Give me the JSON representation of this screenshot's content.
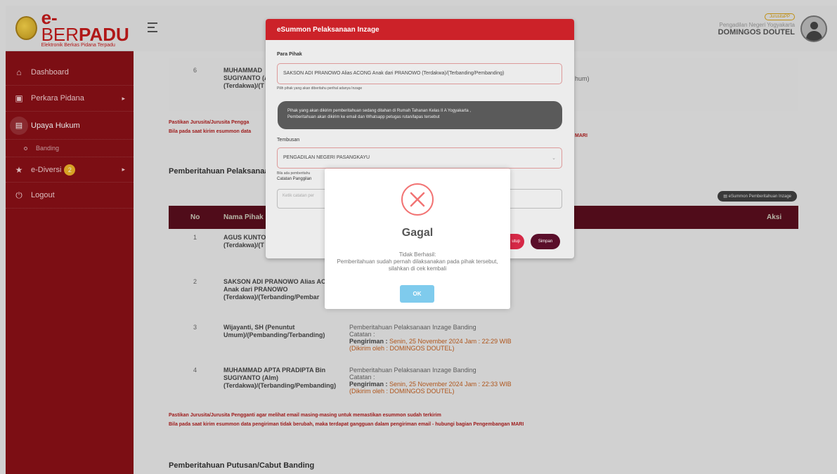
{
  "logo": {
    "brand_e": "e-",
    "brand_ber": "BER",
    "brand_padu": "PADU",
    "subtitle": "Elektronik Berkas Pidana Terpadu"
  },
  "sidebar": {
    "items": [
      {
        "label": "Dashboard",
        "icon": "home-icon"
      },
      {
        "label": "Perkara Pidana",
        "icon": "folder-icon"
      },
      {
        "label": "Upaya Hukum",
        "icon": "document-icon"
      },
      {
        "label": "Banding",
        "icon": "circle-icon"
      },
      {
        "label": "e-Diversi",
        "icon": "star-icon",
        "badge": "2"
      },
      {
        "label": "Logout",
        "icon": "power-icon"
      }
    ]
  },
  "header": {
    "role": "JurusitaPP",
    "court": "Pengadilan Negeri Yogyakarta",
    "user": "DOMINGOS DOUTEL"
  },
  "bg": {
    "row6_no": "6",
    "row6_name_a": "MUHAMMAD",
    "row6_name_b": "SUGIYANTO (A",
    "row6_name_c": "(Terdakwa)/(T",
    "row6_tail": "hum)",
    "warn1a": "Pastikan Jurusita/Jurusita Pengga",
    "warn1b": "Bila pada saat kirim esummon data",
    "warn1_tail": "MARI",
    "section1": "Pemberitahuan Pelaksanaan",
    "summon_btn": "eSummon Pemberitahuan Inzage",
    "col_no": "No",
    "col_nama": "Nama Pihak",
    "col_aksi": "Aksi",
    "r1_no": "1",
    "r1_name_a": "AGUS KUNTO",
    "r1_name_b": "(Terdakwa)/(T",
    "r2_no": "2",
    "r2_name_a": "SAKSON ADI PRANOWO Alias ACC",
    "r2_name_b": "Anak dari PRANOWO",
    "r2_name_c": "(Terdakwa)/(Terbanding/Pembar",
    "r3_no": "3",
    "r3_name_a": "Wijayanti, SH (Penuntut",
    "r3_name_b": "Umum)/(Pembanding/Terbanding)",
    "r3_desc": "Pemberitahuan Pelaksanaan Inzage Banding",
    "r3_catatan": "Catatan :",
    "r3_kirim_label": "Pengiriman :",
    "r3_kirim_val": "Senin, 25 November 2024 Jam : 22:29 WIB",
    "r3_oleh": "(Dikirim oleh : DOMINGOS DOUTEL)",
    "r4_no": "4",
    "r4_name_a": "MUHAMMAD APTA PRADIPTA Bin",
    "r4_name_b": "SUGIYANTO (Alm)",
    "r4_name_c": "(Terdakwa)/(Terbanding/Pembanding)",
    "r4_desc": "Pemberitahuan Pelaksanaan Inzage Banding",
    "r4_catatan": "Catatan :",
    "r4_kirim_label": "Pengiriman :",
    "r4_kirim_val": "Senin, 25 November 2024 Jam : 22:33 WIB",
    "r4_oleh": "(Dikirim oleh : DOMINGOS DOUTEL)",
    "warn2a": "Pastikan Jurusita/Jurusita Pengganti agar melihat email masing-masing untuk memastikan esummon sudah terkirim",
    "warn2b": "Bila pada saat kirim esummon data pengiriman tidak berubah, maka terdapat gangguan dalam pengiriman email - hubungi bagian Pengembangan MARI",
    "section2": "Pemberitahuan Putusan/Cabut Banding"
  },
  "modal": {
    "title": "eSummon Pelaksanaan Inzage",
    "para_pihak_label": "Para Pihak",
    "para_pihak_value": "SAKSON ADI PRANOWO Alias ACONG Anak dari PRANOWO (Terdakwa)/(Terbanding/Pembanding)",
    "para_pihak_help": "Pilih pihak yang akan diberitahu perihal adanya Inzage",
    "alert_line1": "Pihak yang akan dikirim pemberitahuan sedang ditahan di Rumah Tahanan Kelas II A Yogyakarta ,",
    "alert_line2": "Pemberitahuan akan dikirim ke email dan Whatsapp petugas rutan/lapas tersebut",
    "tembusan_label": "Tembusan",
    "tembusan_value": "PENGADILAN NEGERI PASANGKAYU",
    "help2": "Bila ada pemberitahu",
    "catatan_label": "Catatan Panggilan",
    "catatan_placeholder": "Ketik catatan per",
    "btn_tutup": "utup",
    "btn_simpan": "Simpan"
  },
  "dialog": {
    "title": "Gagal",
    "line1": "Tidak Berhasil:",
    "line2": "Pemberitahuan sudah pernah dilaksanakan pada pihak tersebut, silahkan di cek kembali",
    "ok": "OK"
  }
}
